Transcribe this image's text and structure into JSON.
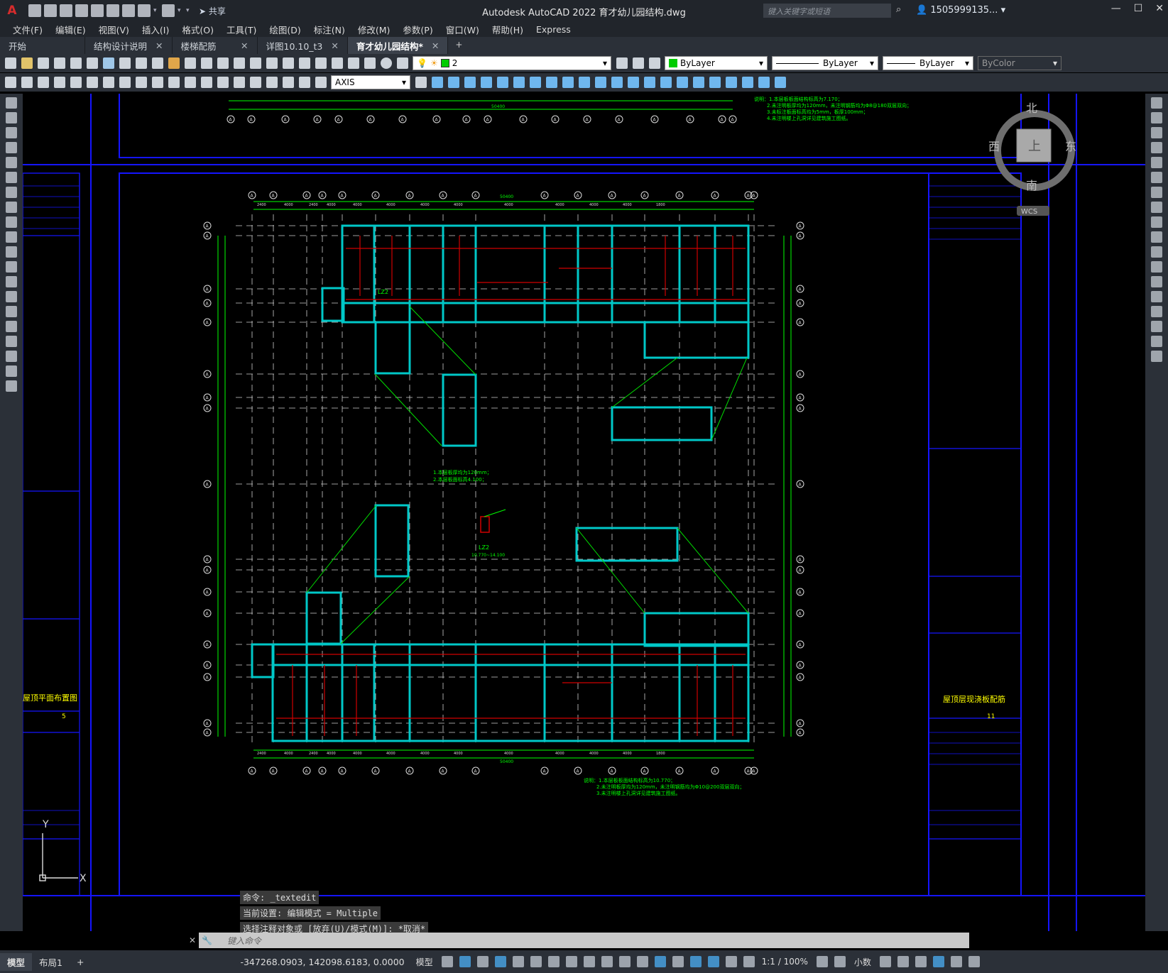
{
  "app": {
    "title": "Autodesk AutoCAD 2022    育才幼儿园结构.dwg",
    "logo": "A",
    "share_label": "共享",
    "search_placeholder": "键入关键字或短语",
    "user": "1505999135...",
    "window_controls": [
      "—",
      "☐",
      "✕"
    ]
  },
  "menu": [
    "文件(F)",
    "编辑(E)",
    "视图(V)",
    "插入(I)",
    "格式(O)",
    "工具(T)",
    "绘图(D)",
    "标注(N)",
    "修改(M)",
    "参数(P)",
    "窗口(W)",
    "帮助(H)",
    "Express"
  ],
  "tabs": [
    {
      "label": "开始",
      "closable": false,
      "active": false
    },
    {
      "label": "结构设计说明",
      "closable": true,
      "active": false
    },
    {
      "label": "楼梯配筋",
      "closable": true,
      "active": false
    },
    {
      "label": "详图10.10_t3",
      "closable": true,
      "active": false
    },
    {
      "label": "育才幼儿园结构*",
      "closable": true,
      "active": true
    }
  ],
  "toolbar": {
    "layer": "2",
    "color": "ByLayer",
    "linetype": "ByLayer",
    "lineweight": "ByLayer",
    "plotstyle": "ByColor",
    "dimstyle": "AXIS"
  },
  "viewcube": {
    "north": "北",
    "south": "南",
    "east": "东",
    "west": "西",
    "face": "上",
    "wcs": "WCS"
  },
  "drawing": {
    "notes_top": [
      "说明：1.本层板板面结构标高为7.170；",
      "2.未注明板厚均为120mm，未注明钢筋均为Φ8@180双层双向；",
      "3.未标注板面标高均为5mm，板厚100mm；",
      "4.未注明楼上孔洞详见建筑施工图纸。"
    ],
    "notes_mid": [
      "1.本层板厚均为120mm；",
      "2.本层板面标高4.100；"
    ],
    "notes_bottom": [
      "说明：1.本层板板面结构标高为10.770；",
      "2.未注明板厚均为120mm，未注明钢筋均为Φ10@200双层双向；",
      "3.未注明楼上孔洞详见建筑施工图纸。"
    ],
    "dim_total": "50400",
    "dims_top": [
      "2400",
      "4000",
      "2400",
      "4000",
      "4000",
      "4000",
      "4000",
      "4000",
      "4000",
      "4000",
      "4000",
      "4000",
      "1800"
    ],
    "left_title": "屋顶平面布置图",
    "left_sheet": "5",
    "right_title": "屋顶层现浇板配筋",
    "right_sheet": "11",
    "label_lz2": "LZ2",
    "label_lz": "LZ2",
    "label_elev": "10.770~14.100",
    "axis_bubble": "A"
  },
  "command": {
    "lines": [
      "命令: _textedit",
      "当前设置: 编辑模式 = Multiple",
      "选择注释对象或 [放弃(U)/模式(M)]: *取消*"
    ],
    "placeholder": "键入命令"
  },
  "ucs": {
    "x": "X",
    "y": "Y"
  },
  "status": {
    "tabs": [
      "模型",
      "布局1"
    ],
    "coords": "-347268.0903, 142098.6183, 0.0000",
    "model_label": "模型",
    "scale": "1:1 / 100%",
    "units": "小数"
  }
}
